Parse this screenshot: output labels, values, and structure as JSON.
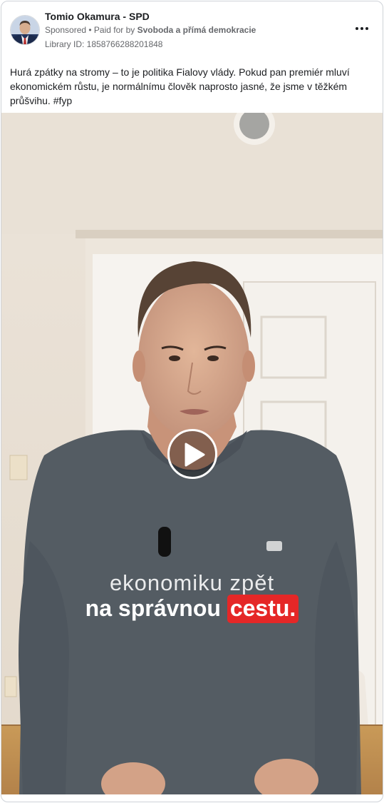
{
  "post": {
    "page_name": "Tomio Okamura - SPD",
    "sponsored_label": "Sponsored",
    "separator": " • ",
    "paid_for_prefix": "Paid for by ",
    "paid_for_by": "Svoboda a přímá demokracie",
    "library_id": "Library ID: 1858766288201848",
    "text": "Hurá zpátky na stromy – to je politika Fialovy vlády. Pokud pan premiér mluví ekonomickém růstu, je normálnímu člověk naprosto jasné, že jsme v těžkém průšvihu. #fyp"
  },
  "video": {
    "caption_line1": "ekonomiku zpět",
    "caption_line2_start": "na správnou ",
    "caption_line2_highlight": "cestu.",
    "highlight_color": "#e52727",
    "icons": {
      "play": "play-icon",
      "more": "more-options-icon",
      "avatar": "page-avatar"
    }
  }
}
